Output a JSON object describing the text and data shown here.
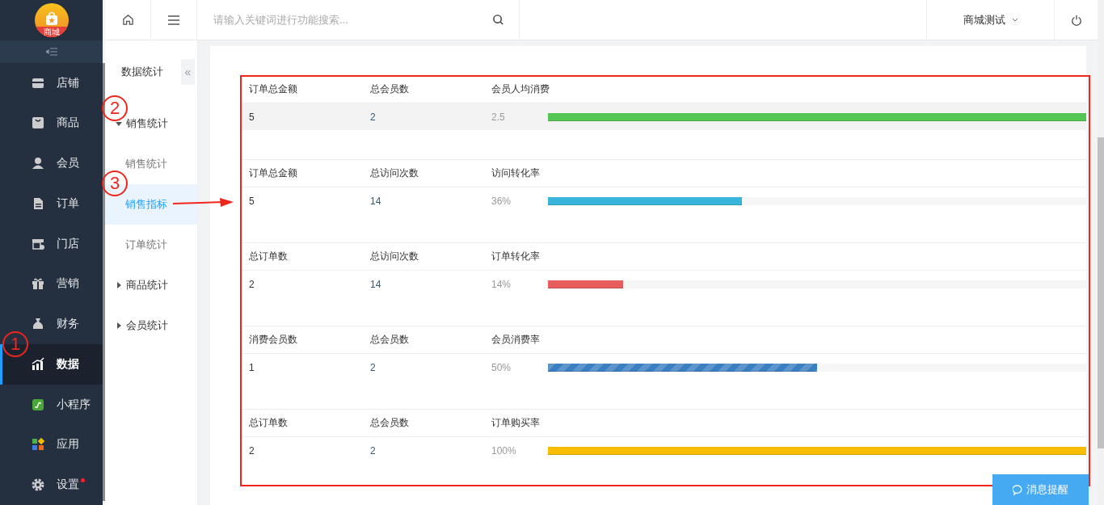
{
  "sidebar": {
    "logo_text": "商城",
    "items": [
      {
        "label": "店铺",
        "selected": false,
        "badge": false
      },
      {
        "label": "商品",
        "selected": false,
        "badge": false
      },
      {
        "label": "会员",
        "selected": false,
        "badge": false
      },
      {
        "label": "订单",
        "selected": false,
        "badge": false
      },
      {
        "label": "门店",
        "selected": false,
        "badge": false
      },
      {
        "label": "营销",
        "selected": false,
        "badge": false
      },
      {
        "label": "财务",
        "selected": false,
        "badge": false
      },
      {
        "label": "数据",
        "selected": true,
        "badge": false
      },
      {
        "label": "小程序",
        "selected": false,
        "badge": false
      },
      {
        "label": "应用",
        "selected": false,
        "badge": false
      },
      {
        "label": "设置",
        "selected": false,
        "badge": true
      }
    ]
  },
  "subnav": {
    "title": "数据统计",
    "collapse": "«",
    "tree": [
      {
        "label": "销售统计",
        "expanded": true,
        "selected": false,
        "children": [
          {
            "label": "销售统计",
            "selected": false
          },
          {
            "label": "销售指标",
            "selected": true
          },
          {
            "label": "订单统计",
            "selected": false
          }
        ]
      },
      {
        "label": "商品统计",
        "expanded": false,
        "selected": false
      },
      {
        "label": "会员统计",
        "expanded": false,
        "selected": false
      }
    ]
  },
  "topbar": {
    "search": {
      "placeholder": "请输入关键词进行功能搜索..."
    },
    "user": "商城测试"
  },
  "metrics": [
    {
      "headers": [
        "订单总金额",
        "总会员数",
        "会员人均消费"
      ],
      "values": [
        "5",
        "2",
        "2.5"
      ],
      "level": 1,
      "color": "#55c553",
      "kind": "solid",
      "shaded": true
    },
    {
      "headers": [
        "订单总金额",
        "总访问次数",
        "访问转化率"
      ],
      "values": [
        "5",
        "14",
        "36%"
      ],
      "level": 0.36,
      "color": "#39b5dc",
      "kind": "solid",
      "shaded": false
    },
    {
      "headers": [
        "总订单数",
        "总访问次数",
        "订单转化率"
      ],
      "values": [
        "2",
        "14",
        "14%"
      ],
      "level": 0.14,
      "color": "#e65e5e",
      "kind": "solid",
      "shaded": false
    },
    {
      "headers": [
        "消费会员数",
        "总会员数",
        "会员消费率"
      ],
      "values": [
        "1",
        "2",
        "50%"
      ],
      "level": 0.5,
      "color": "#3a7fc1",
      "kind": "striped",
      "shaded": false
    },
    {
      "headers": [
        "总订单数",
        "总会员数",
        "订单购买率"
      ],
      "values": [
        "2",
        "2",
        "100%"
      ],
      "level": 1,
      "color": "#f8bd00",
      "kind": "solid",
      "shaded": false
    }
  ],
  "message_button": "消息提醒",
  "annotations": [
    {
      "label": "1"
    },
    {
      "label": "2"
    },
    {
      "label": "3"
    }
  ]
}
